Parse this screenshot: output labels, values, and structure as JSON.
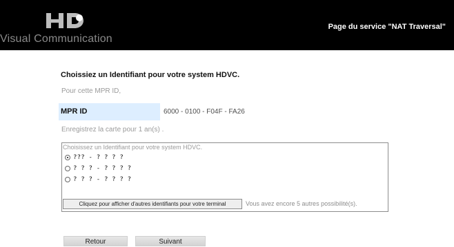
{
  "header": {
    "logo_mark": "HD",
    "logo_text": "Visual Communication",
    "service_title": "Page du service \"NAT Traversal\""
  },
  "page": {
    "heading": "Choissiez un Identifiant pour votre system HDVC.",
    "for_mpr": "Pour cette MPR ID,",
    "mpr_label": "MPR ID",
    "mpr_value": "6000 - 0100 - F04F - FA26",
    "register_period": "Enregistrez la carte pour 1 an(s) ."
  },
  "choices": {
    "title": "Choisissez un Identifiant pour votre system HDVC.",
    "items": [
      {
        "label": "??? - ? ? ? ?",
        "selected": true
      },
      {
        "label": "? ? ? - ? ? ? ?",
        "selected": false
      },
      {
        "label": "? ? ? - ? ? ? ?",
        "selected": false
      }
    ],
    "more_button": "Cliquez pour afficher d'autres identifiants pour votre terminal",
    "remaining_text": "Vous avez encore 5 autres possibilité(s)."
  },
  "navigation": {
    "back": "Retour",
    "next": "Suivant"
  },
  "colors": {
    "header_bg": "#000000",
    "mpr_label_bg": "#ddeeff",
    "text_muted": "#9a9a9a"
  }
}
